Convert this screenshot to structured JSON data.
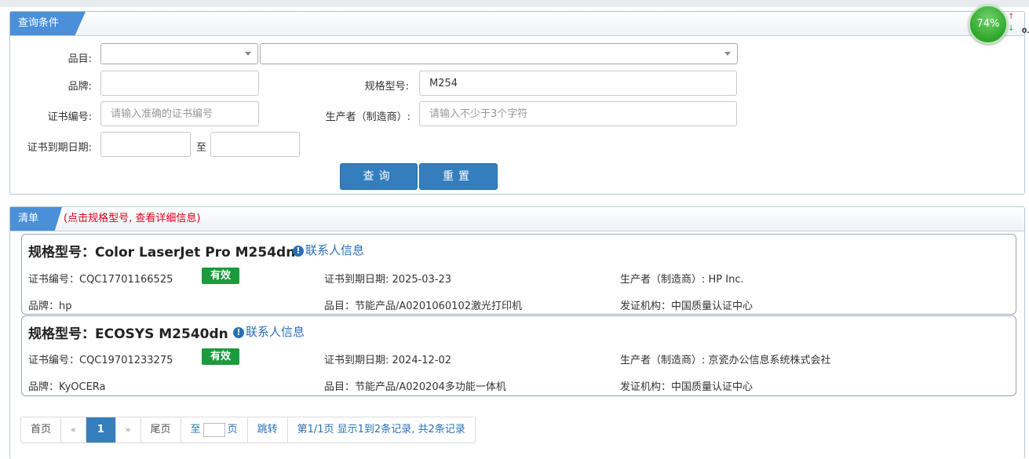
{
  "query": {
    "header": "查询条件",
    "labels": {
      "category": "品目:",
      "brand": "品牌:",
      "model": "规格型号:",
      "cert_no": "证书编号:",
      "manufacturer": "生产者（制造商）:",
      "expiry": "证书到期日期:",
      "to": "至"
    },
    "fields": {
      "category1": "",
      "category2": "",
      "brand": "",
      "model": "M254",
      "cert_no_placeholder": "请输入准确的证书编号",
      "manufacturer_placeholder": "请输入不少于3个字符",
      "expiry_from": "",
      "expiry_to": ""
    },
    "buttons": {
      "search": "查询",
      "reset": "重置"
    }
  },
  "list": {
    "header": "清单",
    "note": "(点击规格型号, 查看详细信息)",
    "contact_label": "联系人信息",
    "items": [
      {
        "title": "规格型号：Color LaserJet Pro M254dn",
        "cert_no": "证书编号：CQC17701166525",
        "status": "有效",
        "expiry": "证书到期日期: 2025-03-23",
        "manufacturer": "生产者（制造商）: HP Inc.",
        "brand": "品牌：hp",
        "category": "品目：节能产品/A0201060102激光打印机",
        "issuer": "发证机构：中国质量认证中心"
      },
      {
        "title": "规格型号：ECOSYS M2540dn",
        "cert_no": "证书编号：CQC19701233275",
        "status": "有效",
        "expiry": "证书到期日期: 2024-12-02",
        "manufacturer": "生产者（制造商）: 京瓷办公信息系统株式会社",
        "brand": "品牌：KyOCERa",
        "category": "品目：节能产品/A020204多功能一体机",
        "issuer": "发证机构：中国质量认证中心"
      }
    ]
  },
  "pagination": {
    "first": "首页",
    "prev": "«",
    "current": "1",
    "next": "»",
    "last": "尾页",
    "goto_prefix": "至",
    "goto_suffix": "页",
    "jump": "跳转",
    "summary": "第1/1页  显示1到2条记录, 共2条记录"
  },
  "widget": {
    "percent": "74%",
    "value": "0."
  },
  "colors": {
    "accent": "#357ebd",
    "tab": "#4a8fd8",
    "valid": "#1a9b3c",
    "note": "#d9001b"
  }
}
